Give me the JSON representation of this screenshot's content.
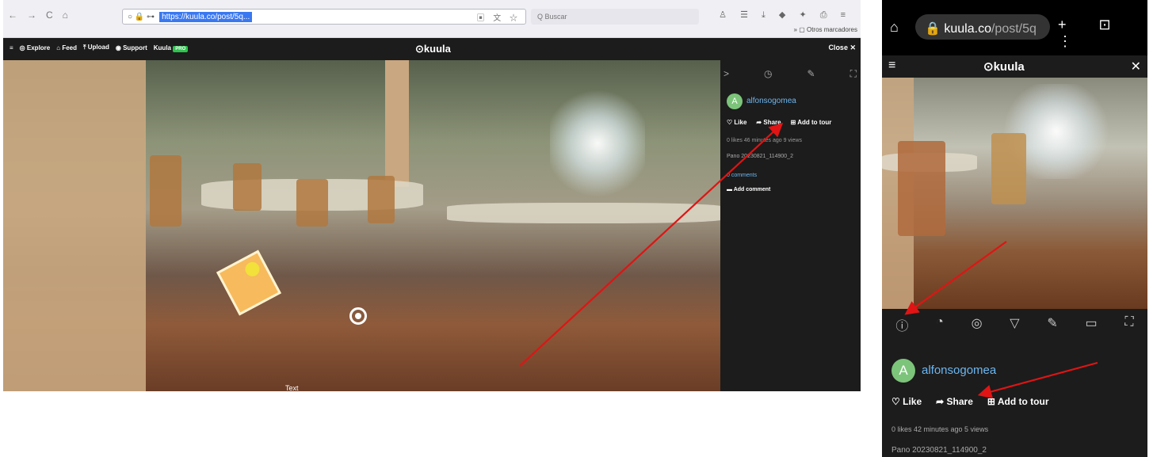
{
  "desktop": {
    "browser": {
      "nav_icons": [
        "←",
        "→",
        "C",
        "⌂"
      ],
      "url_icons": "○ 🔒 ⊶",
      "url": "https://kuula.co/post/5q...",
      "url_right_icons": "▣ 文 ☆",
      "search_placeholder": "Q Buscar",
      "toolbar_icons": "♙ ☰ ⤓ ◆ ✦ ⎙ ≡",
      "bookmarks": "» ▢ Otros marcadores"
    },
    "kuula_topbar": {
      "menu_icon": "≡",
      "items": [
        "Explore",
        "Feed",
        "Upload",
        "Support",
        "Kuula"
      ],
      "item_icons": [
        "◎",
        "⌂",
        "⤒",
        "◉"
      ],
      "pro_badge": "PRO",
      "logo": "⊙kuula",
      "close": "Close ✕"
    },
    "pano": {
      "label": "Text"
    },
    "sidebar": {
      "tabs": [
        ">",
        "◷",
        "✎",
        "⛶"
      ],
      "avatar_letter": "A",
      "username": "alfonsogomea",
      "like": "Like",
      "share": "Share",
      "add_to_tour": "Add to tour",
      "meta": "0 likes   46 minutes ago   9 views",
      "pano_name": "Pano 20230821_114900_2",
      "comments": "0 comments",
      "add_comment": "Add comment"
    }
  },
  "mobile": {
    "browser": {
      "home_icon": "⌂",
      "url_main": "🔒 kuula.co",
      "url_dim": "/post/5q",
      "right_icons": "+ ⊡ ⋮"
    },
    "kuula_topbar": {
      "menu_icon": "≡",
      "logo": "⊙kuula",
      "close_icon": "✕"
    },
    "toolbar_icons": [
      "ⓘ",
      "◔",
      "◎",
      "▽",
      "✎",
      "▭",
      "⛶"
    ],
    "avatar_letter": "A",
    "username": "alfonsogomea",
    "like": "Like",
    "share": "Share",
    "add_to_tour": "Add to tour",
    "meta": "0 likes   42 minutes ago   5 views",
    "pano_name": "Pano 20230821_114900_2"
  },
  "colors": {
    "annotation_arrow": "#e01414",
    "link_blue": "#6cb6f0",
    "avatar_green": "#7cc47a",
    "pro_green": "#2fc24f",
    "kuula_dark": "#1c1c1c"
  }
}
